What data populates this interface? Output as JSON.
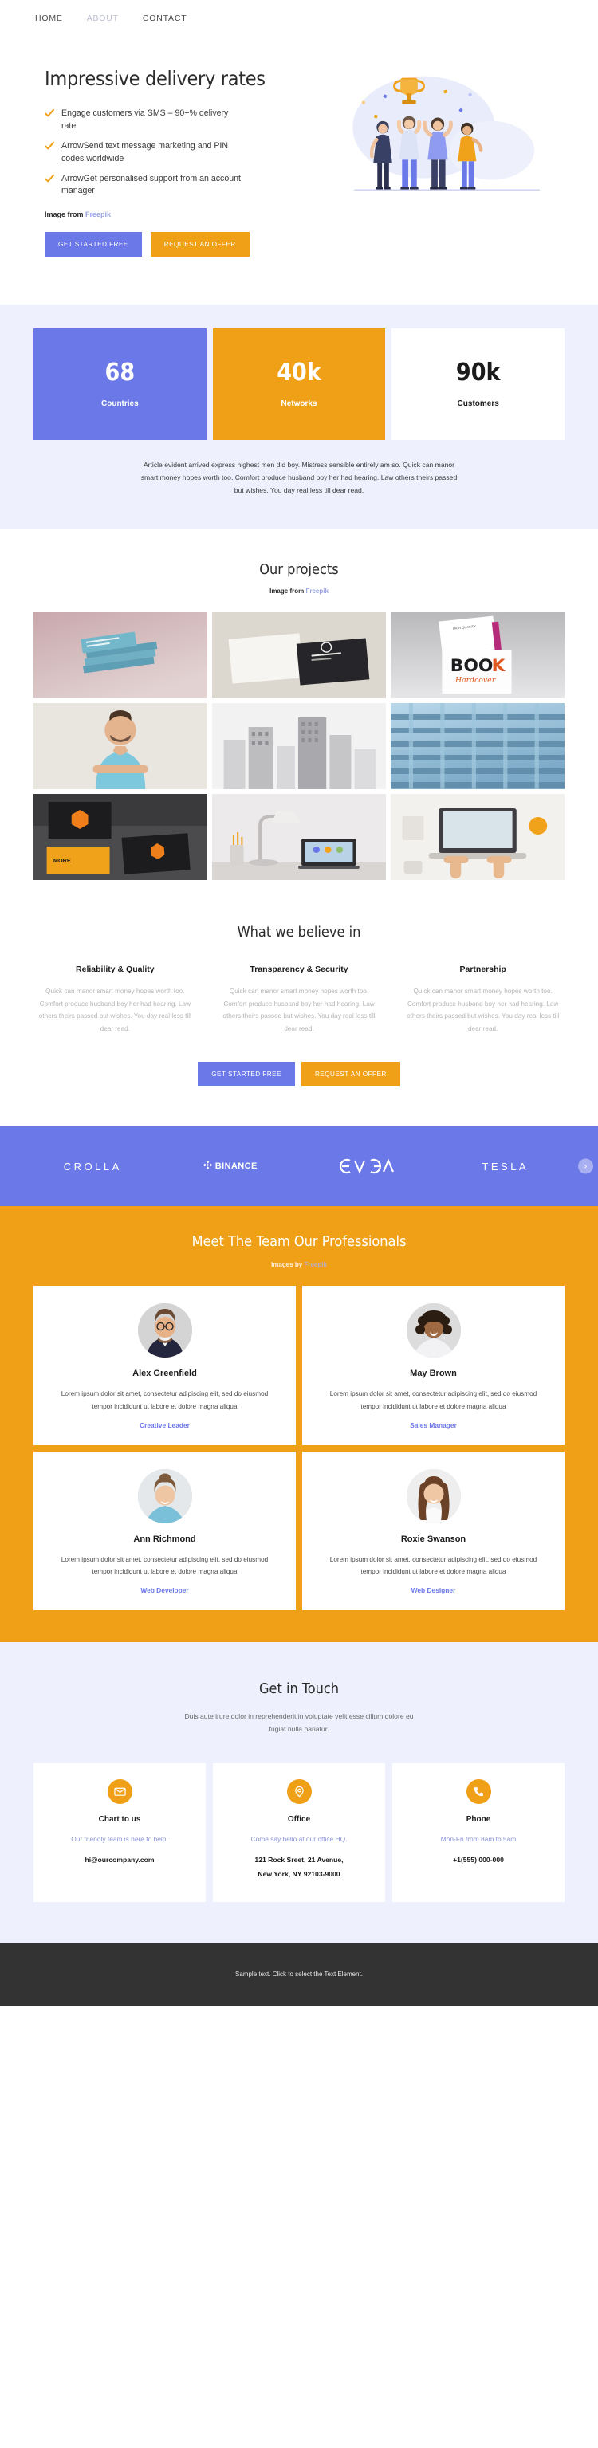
{
  "nav": {
    "items": [
      {
        "label": "HOME",
        "state": "normal"
      },
      {
        "label": "ABOUT",
        "state": "muted"
      },
      {
        "label": "CONTACT",
        "state": "normal"
      }
    ]
  },
  "hero": {
    "title": "Impressive delivery rates",
    "bullets": [
      "Engage customers via SMS – 90+% delivery rate",
      "ArrowSend text message marketing and PIN codes worldwide",
      "ArrowGet personalised support from an account manager"
    ],
    "credit_prefix": "Image from ",
    "credit_link": "Freepik",
    "primary_button": "GET STARTED FREE",
    "accent_button": "REQUEST AN OFFER",
    "illustration_alt": "team celebrating with trophy"
  },
  "stats": {
    "cards": [
      {
        "number": "68",
        "label": "Countries",
        "style": "blue"
      },
      {
        "number": "40k",
        "label": "Networks",
        "style": "orange"
      },
      {
        "number": "90k",
        "label": "Customers",
        "style": "white"
      }
    ],
    "note": "Article evident arrived express highest men did boy. Mistress sensible entirely am so. Quick can manor smart money hopes worth too. Comfort produce husband boy her had hearing. Law others theirs passed but wishes. You day real less till dear read."
  },
  "projects": {
    "title": "Our projects",
    "credit_prefix": "Image from ",
    "credit_link": "Freepik",
    "items": [
      {
        "alt": "stack of blue book covers"
      },
      {
        "alt": "black and white business cards"
      },
      {
        "alt": "book cover mockup BOOK Hardcover"
      },
      {
        "alt": "smiling man in blue polo shirt"
      },
      {
        "alt": "city skyline buildings black and white"
      },
      {
        "alt": "modern glass office facade"
      },
      {
        "alt": "black and orange branding stationery"
      },
      {
        "alt": "desk lamp with laptop and pencils"
      },
      {
        "alt": "hands typing on laptop from above"
      }
    ]
  },
  "believe": {
    "title": "What we believe in",
    "columns": [
      {
        "heading": "Reliability & Quality",
        "text": "Quick can manor smart money hopes worth too. Comfort produce husband boy her had hearing. Law others theirs passed but wishes. You day real less till dear read."
      },
      {
        "heading": "Transparency & Security",
        "text": "Quick can manor smart money hopes worth too. Comfort produce husband boy her had hearing. Law others theirs passed but wishes. You day real less till dear read."
      },
      {
        "heading": "Partnership",
        "text": "Quick can manor smart money hopes worth too. Comfort produce husband boy her had hearing. Law others theirs passed but wishes. You day real less till dear read."
      }
    ],
    "primary_button": "GET STARTED FREE",
    "accent_button": "REQUEST AN OFFER"
  },
  "brands": {
    "items": [
      {
        "name": "CROLLA",
        "kind": "text"
      },
      {
        "name": "BINANCE",
        "kind": "binance"
      },
      {
        "name": "EVGA",
        "kind": "evga"
      },
      {
        "name": "TESLA",
        "kind": "text"
      }
    ],
    "next_label": "›"
  },
  "team": {
    "title": "Meet The Team Our Professionals",
    "credit_prefix": "Images by ",
    "credit_link": "Freepik",
    "members": [
      {
        "name": "Alex Greenfield",
        "bio": "Lorem ipsum dolor sit amet, consectetur adipiscing elit, sed do eiusmod tempor incididunt ut labore et dolore magna aliqua",
        "role": "Creative Leader",
        "avatar_alt": "man with glasses in navy blazer"
      },
      {
        "name": "May Brown",
        "bio": "Lorem ipsum dolor sit amet, consectetur adipiscing elit, sed do eiusmod tempor incididunt ut labore et dolore magna aliqua",
        "role": "Sales Manager",
        "avatar_alt": "smiling woman with curly hair"
      },
      {
        "name": "Ann Richmond",
        "bio": "Lorem ipsum dolor sit amet, consectetur adipiscing elit, sed do eiusmod tempor incididunt ut labore et dolore magna aliqua",
        "role": "Web Developer",
        "avatar_alt": "woman with hair bun in blue top"
      },
      {
        "name": "Roxie Swanson",
        "bio": "Lorem ipsum dolor sit amet, consectetur adipiscing elit, sed do eiusmod tempor incididunt ut labore et dolore magna aliqua",
        "role": "Web Designer",
        "avatar_alt": "woman with long brown hair"
      }
    ]
  },
  "contact": {
    "title": "Get in Touch",
    "subtitle": "Duis aute irure dolor in reprehenderit in voluptate velit esse cillum dolore eu fugiat nulla pariatur.",
    "cards": [
      {
        "icon": "envelope-icon",
        "heading": "Chart to us",
        "note": "Our friendly team is here to help.",
        "value_1": "hi@ourcompany.com",
        "value_2": ""
      },
      {
        "icon": "map-pin-icon",
        "heading": "Office",
        "note": "Come say hello at our office HQ.",
        "value_1": "121 Rock Sreet, 21 Avenue,",
        "value_2": "New York, NY 92103-9000"
      },
      {
        "icon": "phone-icon",
        "heading": "Phone",
        "note": "Mon-Fri from 8am to 5am",
        "value_1": "+1(555) 000-000",
        "value_2": ""
      }
    ]
  },
  "footer": {
    "text": "Sample text. Click to select the Text Element."
  },
  "colors": {
    "primary": "#6b78e8",
    "accent": "#efa017",
    "lavender_bg": "#eef0fd",
    "footer_bg": "#333333",
    "link": "#9aa5e0"
  }
}
